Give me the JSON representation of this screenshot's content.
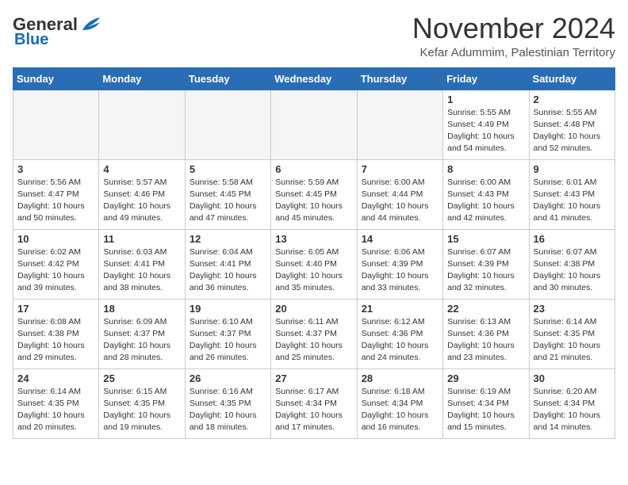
{
  "logo": {
    "general": "General",
    "blue": "Blue"
  },
  "title": "November 2024",
  "location": "Kefar Adummim, Palestinian Territory",
  "days_of_week": [
    "Sunday",
    "Monday",
    "Tuesday",
    "Wednesday",
    "Thursday",
    "Friday",
    "Saturday"
  ],
  "weeks": [
    [
      {
        "day": "",
        "info": ""
      },
      {
        "day": "",
        "info": ""
      },
      {
        "day": "",
        "info": ""
      },
      {
        "day": "",
        "info": ""
      },
      {
        "day": "",
        "info": ""
      },
      {
        "day": "1",
        "info": "Sunrise: 5:55 AM\nSunset: 4:49 PM\nDaylight: 10 hours\nand 54 minutes."
      },
      {
        "day": "2",
        "info": "Sunrise: 5:55 AM\nSunset: 4:48 PM\nDaylight: 10 hours\nand 52 minutes."
      }
    ],
    [
      {
        "day": "3",
        "info": "Sunrise: 5:56 AM\nSunset: 4:47 PM\nDaylight: 10 hours\nand 50 minutes."
      },
      {
        "day": "4",
        "info": "Sunrise: 5:57 AM\nSunset: 4:46 PM\nDaylight: 10 hours\nand 49 minutes."
      },
      {
        "day": "5",
        "info": "Sunrise: 5:58 AM\nSunset: 4:45 PM\nDaylight: 10 hours\nand 47 minutes."
      },
      {
        "day": "6",
        "info": "Sunrise: 5:59 AM\nSunset: 4:45 PM\nDaylight: 10 hours\nand 45 minutes."
      },
      {
        "day": "7",
        "info": "Sunrise: 6:00 AM\nSunset: 4:44 PM\nDaylight: 10 hours\nand 44 minutes."
      },
      {
        "day": "8",
        "info": "Sunrise: 6:00 AM\nSunset: 4:43 PM\nDaylight: 10 hours\nand 42 minutes."
      },
      {
        "day": "9",
        "info": "Sunrise: 6:01 AM\nSunset: 4:43 PM\nDaylight: 10 hours\nand 41 minutes."
      }
    ],
    [
      {
        "day": "10",
        "info": "Sunrise: 6:02 AM\nSunset: 4:42 PM\nDaylight: 10 hours\nand 39 minutes."
      },
      {
        "day": "11",
        "info": "Sunrise: 6:03 AM\nSunset: 4:41 PM\nDaylight: 10 hours\nand 38 minutes."
      },
      {
        "day": "12",
        "info": "Sunrise: 6:04 AM\nSunset: 4:41 PM\nDaylight: 10 hours\nand 36 minutes."
      },
      {
        "day": "13",
        "info": "Sunrise: 6:05 AM\nSunset: 4:40 PM\nDaylight: 10 hours\nand 35 minutes."
      },
      {
        "day": "14",
        "info": "Sunrise: 6:06 AM\nSunset: 4:39 PM\nDaylight: 10 hours\nand 33 minutes."
      },
      {
        "day": "15",
        "info": "Sunrise: 6:07 AM\nSunset: 4:39 PM\nDaylight: 10 hours\nand 32 minutes."
      },
      {
        "day": "16",
        "info": "Sunrise: 6:07 AM\nSunset: 4:38 PM\nDaylight: 10 hours\nand 30 minutes."
      }
    ],
    [
      {
        "day": "17",
        "info": "Sunrise: 6:08 AM\nSunset: 4:38 PM\nDaylight: 10 hours\nand 29 minutes."
      },
      {
        "day": "18",
        "info": "Sunrise: 6:09 AM\nSunset: 4:37 PM\nDaylight: 10 hours\nand 28 minutes."
      },
      {
        "day": "19",
        "info": "Sunrise: 6:10 AM\nSunset: 4:37 PM\nDaylight: 10 hours\nand 26 minutes."
      },
      {
        "day": "20",
        "info": "Sunrise: 6:11 AM\nSunset: 4:37 PM\nDaylight: 10 hours\nand 25 minutes."
      },
      {
        "day": "21",
        "info": "Sunrise: 6:12 AM\nSunset: 4:36 PM\nDaylight: 10 hours\nand 24 minutes."
      },
      {
        "day": "22",
        "info": "Sunrise: 6:13 AM\nSunset: 4:36 PM\nDaylight: 10 hours\nand 23 minutes."
      },
      {
        "day": "23",
        "info": "Sunrise: 6:14 AM\nSunset: 4:35 PM\nDaylight: 10 hours\nand 21 minutes."
      }
    ],
    [
      {
        "day": "24",
        "info": "Sunrise: 6:14 AM\nSunset: 4:35 PM\nDaylight: 10 hours\nand 20 minutes."
      },
      {
        "day": "25",
        "info": "Sunrise: 6:15 AM\nSunset: 4:35 PM\nDaylight: 10 hours\nand 19 minutes."
      },
      {
        "day": "26",
        "info": "Sunrise: 6:16 AM\nSunset: 4:35 PM\nDaylight: 10 hours\nand 18 minutes."
      },
      {
        "day": "27",
        "info": "Sunrise: 6:17 AM\nSunset: 4:34 PM\nDaylight: 10 hours\nand 17 minutes."
      },
      {
        "day": "28",
        "info": "Sunrise: 6:18 AM\nSunset: 4:34 PM\nDaylight: 10 hours\nand 16 minutes."
      },
      {
        "day": "29",
        "info": "Sunrise: 6:19 AM\nSunset: 4:34 PM\nDaylight: 10 hours\nand 15 minutes."
      },
      {
        "day": "30",
        "info": "Sunrise: 6:20 AM\nSunset: 4:34 PM\nDaylight: 10 hours\nand 14 minutes."
      }
    ]
  ]
}
